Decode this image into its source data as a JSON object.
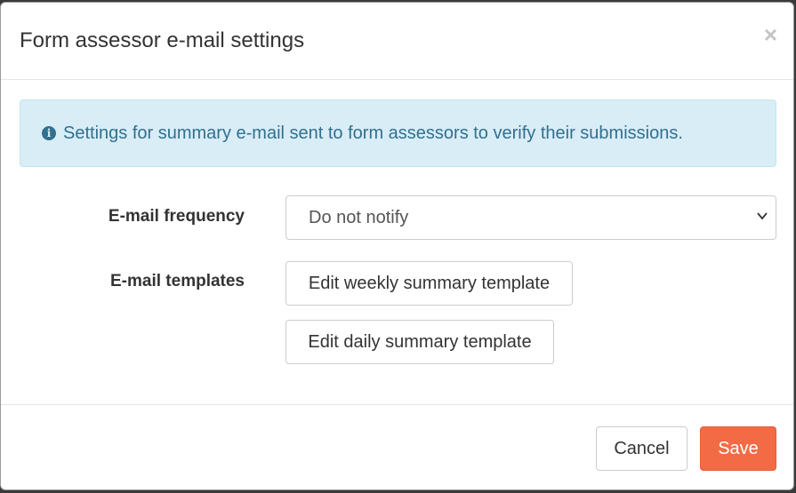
{
  "dialog": {
    "title": "Form assessor e-mail settings",
    "close_symbol": "×"
  },
  "alert": {
    "icon": "info-circle-icon",
    "text": "Settings for summary e-mail sent to form assessors to verify their submissions."
  },
  "form": {
    "frequency_label": "E-mail frequency",
    "frequency_value": "Do not notify",
    "templates_label": "E-mail templates",
    "weekly_button": "Edit weekly summary template",
    "daily_button": "Edit daily summary template"
  },
  "footer": {
    "cancel_label": "Cancel",
    "save_label": "Save"
  },
  "colors": {
    "save_button": "#f26b45",
    "alert_background": "#d9edf7",
    "alert_text": "#31708f"
  }
}
